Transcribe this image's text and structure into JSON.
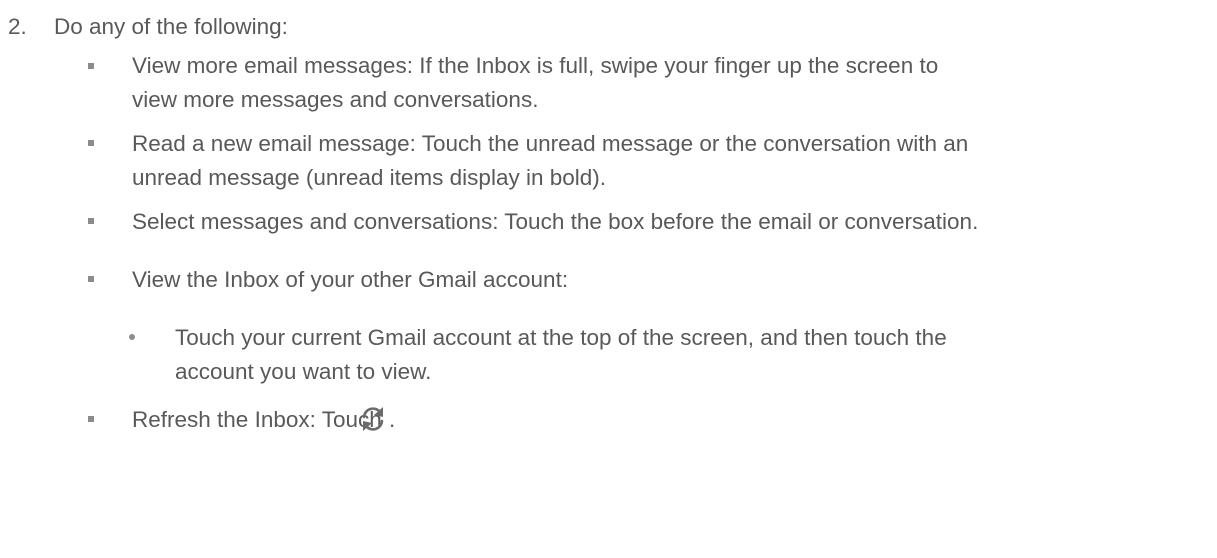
{
  "step": {
    "number": "2.",
    "intro": "Do any of the following:"
  },
  "items": [
    {
      "lines": [
        "View more email messages: If the Inbox is full, swipe your finger up the screen to",
        "view more messages and conversations."
      ]
    },
    {
      "lines": [
        "Read a new email message: Touch the unread message or the conversation with an",
        "unread message (unread items display in bold)."
      ]
    },
    {
      "lines": [
        "Select messages and conversations: Touch the box before the email or conversation."
      ]
    },
    {
      "lines": [
        "View the Inbox of your other Gmail account:"
      ],
      "subitems": [
        {
          "lines": [
            "Touch your current Gmail account at the top of the screen, and then touch the",
            "account you want to view."
          ]
        }
      ]
    },
    {
      "lines": [
        "Refresh the Inbox: Touch ",
        "."
      ],
      "icon": "refresh-icon"
    }
  ]
}
